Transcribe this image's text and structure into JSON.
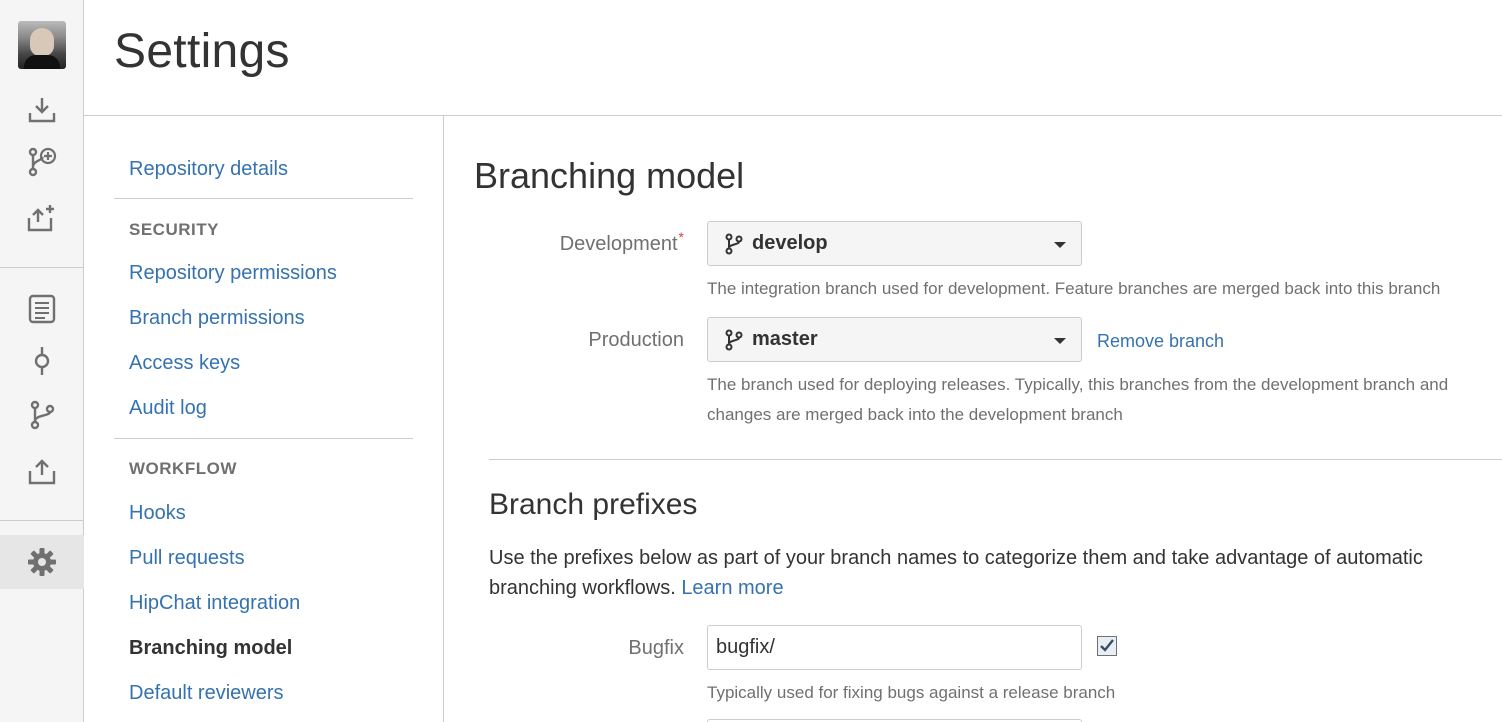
{
  "header": {
    "title": "Settings"
  },
  "rail": {
    "icons": [
      "avatar",
      "download-icon",
      "create-branch-icon",
      "create-fork-icon",
      "source-icon",
      "commits-icon",
      "branches-icon",
      "pull-request-icon",
      "settings-icon"
    ],
    "active": "settings-icon"
  },
  "nav": {
    "repository_details": "Repository details",
    "security_heading": "SECURITY",
    "security_items": [
      "Repository permissions",
      "Branch permissions",
      "Access keys",
      "Audit log"
    ],
    "workflow_heading": "WORKFLOW",
    "workflow_items": [
      "Hooks",
      "Pull requests",
      "HipChat integration",
      "Branching model",
      "Default reviewers"
    ],
    "current": "Branching model"
  },
  "branching": {
    "title": "Branching model",
    "development": {
      "label": "Development",
      "required_mark": "*",
      "value": "develop",
      "description": "The integration branch used for development. Feature branches are merged back into this branch"
    },
    "production": {
      "label": "Production",
      "value": "master",
      "remove_label": "Remove branch",
      "description_line1": "The branch used for deploying releases. Typically, this branches from the development branch and",
      "description_line2": "changes are merged back into the development branch"
    }
  },
  "prefixes": {
    "title": "Branch prefixes",
    "intro_line1": "Use the prefixes below as part of your branch names to categorize them and take advantage of automatic",
    "intro_line2": "branching workflows.",
    "learn_more": "Learn more",
    "bugfix": {
      "label": "Bugfix",
      "value": "bugfix/",
      "enabled": true,
      "description": "Typically used for fixing bugs against a release branch"
    }
  },
  "colors": {
    "link": "#3572b0",
    "text": "#333333",
    "muted": "#707070",
    "required": "#d04437",
    "border": "#cccccc"
  }
}
